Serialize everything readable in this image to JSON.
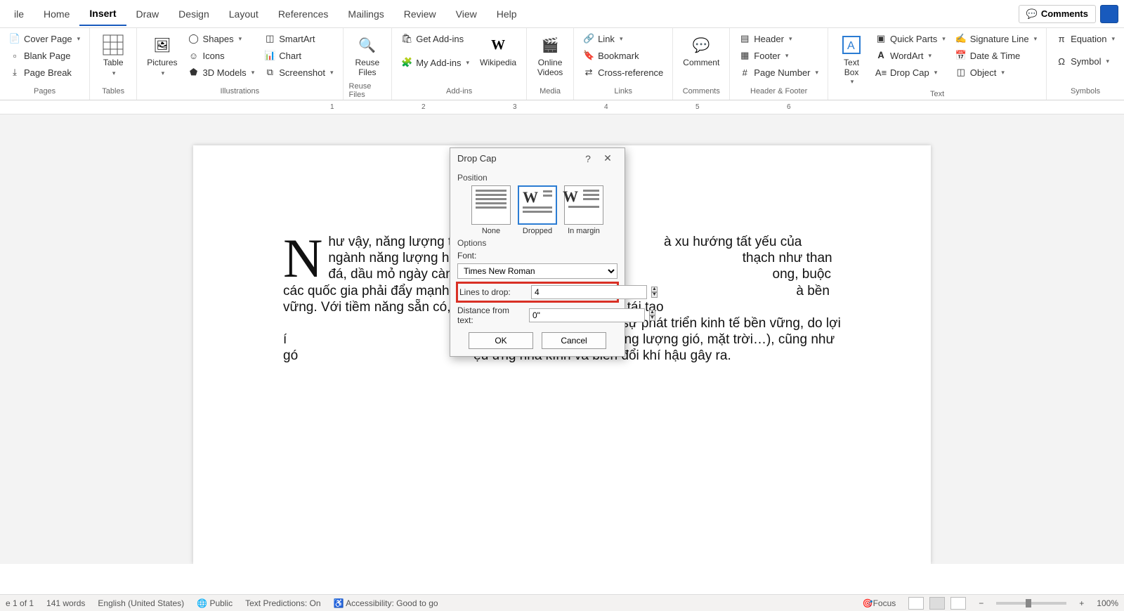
{
  "tabs": {
    "file": "ile",
    "home": "Home",
    "insert": "Insert",
    "draw": "Draw",
    "design": "Design",
    "layout": "Layout",
    "references": "References",
    "mailings": "Mailings",
    "review": "Review",
    "view": "View",
    "help": "Help"
  },
  "tabsRight": {
    "comments": "Comments"
  },
  "ribbon": {
    "pages": {
      "label": "Pages",
      "cover": "Cover Page",
      "blank": "Blank Page",
      "break": "Page Break"
    },
    "tables": {
      "label": "Tables",
      "table": "Table"
    },
    "illustrations": {
      "label": "Illustrations",
      "pictures": "Pictures",
      "shapes": "Shapes",
      "icons": "Icons",
      "models": "3D Models",
      "smartart": "SmartArt",
      "chart": "Chart",
      "screenshot": "Screenshot"
    },
    "reuse": {
      "label": "Reuse Files",
      "btn": "Reuse\nFiles"
    },
    "addins": {
      "label": "Add-ins",
      "get": "Get Add-ins",
      "my": "My Add-ins",
      "wiki": "Wikipedia"
    },
    "media": {
      "label": "Media",
      "online": "Online\nVideos"
    },
    "links": {
      "label": "Links",
      "link": "Link",
      "bookmark": "Bookmark",
      "crossref": "Cross-reference"
    },
    "comments": {
      "label": "Comments",
      "comment": "Comment"
    },
    "hf": {
      "label": "Header & Footer",
      "header": "Header",
      "footer": "Footer",
      "pagenum": "Page Number"
    },
    "text": {
      "label": "Text",
      "textbox": "Text\nBox",
      "quickparts": "Quick Parts",
      "wordart": "WordArt",
      "dropcap": "Drop Cap",
      "sigline": "Signature Line",
      "datetime": "Date & Time",
      "object": "Object"
    },
    "symbols": {
      "label": "Symbols",
      "equation": "Equation",
      "symbol": "Symbol"
    }
  },
  "ruler": {
    "marks": [
      "1",
      "2",
      "3",
      "4",
      "5",
      "6"
    ]
  },
  "document": {
    "dropcap": "N",
    "text_a": "hư vậy, năng lượng tái tạo ",
    "text_b": "à xu hướng tất yếu của ngành năng lượng hiện nay ở Việt Nam",
    "text_c": " thạch như than đá, dầu mỏ ngày càng trở nên cạn kiệt, gây ố",
    "text_d": "ong, buộc các quốc gia phải đẩy mạnh chuyển dịch cơ cấu ngành n",
    "text_e": "à bền vững. Với tiềm năng sẵn có, phát triển nguồn năng lượng tái tạo ",
    "text_f": "hiếm vị trí quan trọng trong sự phát triển kinh tế bền vững, do lợi í",
    "text_g": "ối đa nguồn thiên nhiên (năng lượng gió, mặt trời…), cũng như gó",
    "text_h": "ệu ứng nhà kính và biến đổi khí hậu gây ra."
  },
  "dialog": {
    "title": "Drop Cap",
    "position": "Position",
    "none": "None",
    "dropped": "Dropped",
    "inmargin": "In margin",
    "options": "Options",
    "font": "Font:",
    "font_val": "Times New Roman",
    "lines": "Lines to drop:",
    "lines_val": "4",
    "dist": "Distance from text:",
    "dist_val": "0\"",
    "ok": "OK",
    "cancel": "Cancel"
  },
  "status": {
    "page": "e 1 of 1",
    "words": "141 words",
    "lang": "English (United States)",
    "public": "Public",
    "pred": "Text Predictions: On",
    "access": "Accessibility: Good to go",
    "focus": "Focus",
    "zoom": "100%"
  }
}
